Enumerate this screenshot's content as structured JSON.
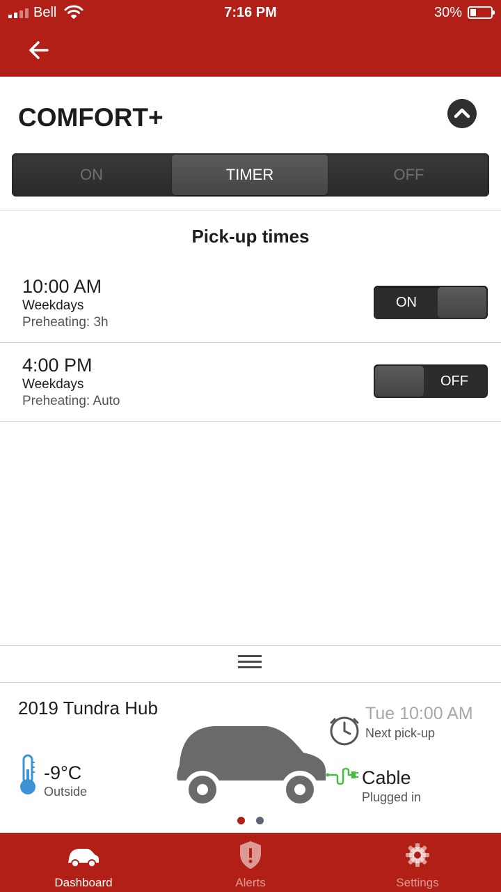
{
  "status_bar": {
    "carrier": "Bell",
    "time": "7:16 PM",
    "battery_percent": "30%",
    "battery_level": 0.3
  },
  "comfort": {
    "title": "COMFORT+",
    "modes": [
      "ON",
      "TIMER",
      "OFF"
    ],
    "selected_mode": "TIMER"
  },
  "pickup": {
    "title": "Pick-up times",
    "items": [
      {
        "time": "10:00 AM",
        "days": "Weekdays",
        "preheating": "Preheating: 3h",
        "toggle_label": "ON",
        "enabled": true
      },
      {
        "time": "4:00 PM",
        "days": "Weekdays",
        "preheating": "Preheating: Auto",
        "toggle_label": "OFF",
        "enabled": false
      }
    ]
  },
  "vehicle": {
    "name": "2019 Tundra Hub",
    "temperature": "-9°C",
    "temperature_label": "Outside",
    "next_pickup_time": "Tue 10:00 AM",
    "next_pickup_label": "Next pick-up",
    "cable_status": "Cable",
    "cable_label": "Plugged in",
    "page_index": 1,
    "page_count": 2
  },
  "nav": {
    "items": [
      {
        "label": "Dashboard",
        "icon": "car-icon",
        "active": true
      },
      {
        "label": "Alerts",
        "icon": "shield-alert-icon",
        "active": false
      },
      {
        "label": "Settings",
        "icon": "gear-icon",
        "active": false
      }
    ]
  },
  "colors": {
    "brand_red": "#b11f16",
    "dark_control": "#2c2c2c",
    "thermometer_blue": "#3c94d6",
    "plug_green": "#3fbf3f",
    "page_dot_active": "#b11f16",
    "page_dot_inactive": "#5b6470"
  }
}
